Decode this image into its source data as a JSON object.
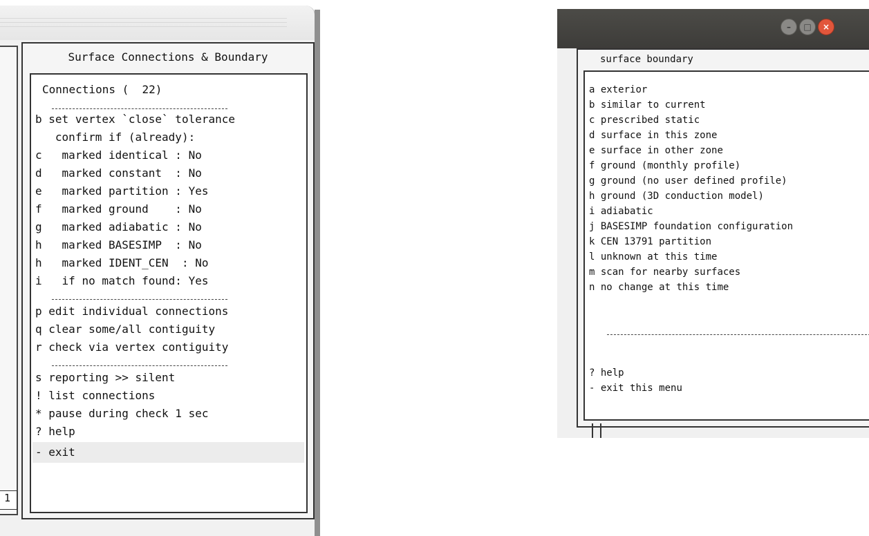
{
  "left_window": {
    "partial_field_char": "1",
    "panel_title": "Surface Connections & Boundary",
    "heading": "Connections (  22)",
    "separator": "----------------------",
    "items": [
      {
        "key": "b",
        "text": "set vertex `close` tolerance"
      },
      {
        "key": "",
        "text": " confirm if (already):"
      },
      {
        "key": "c",
        "text": "  marked identical : No"
      },
      {
        "key": "d",
        "text": "  marked constant  : No"
      },
      {
        "key": "e",
        "text": "  marked partition : Yes"
      },
      {
        "key": "f",
        "text": "  marked ground    : No"
      },
      {
        "key": "g",
        "text": "  marked adiabatic : No"
      },
      {
        "key": "h",
        "text": "  marked BASESIMP  : No"
      },
      {
        "key": "h",
        "text": "  marked IDENT_CEN  : No"
      },
      {
        "key": "i",
        "text": "  if no match found: Yes"
      }
    ],
    "items2": [
      {
        "key": "p",
        "text": "edit individual connections"
      },
      {
        "key": "q",
        "text": "clear some/all contiguity"
      },
      {
        "key": "r",
        "text": "check via vertex contiguity"
      }
    ],
    "items3": [
      {
        "key": "s",
        "text": "reporting >> silent"
      },
      {
        "key": "!",
        "text": "list connections"
      },
      {
        "key": "*",
        "text": "pause during check 1 sec"
      },
      {
        "key": "?",
        "text": "help"
      },
      {
        "key": "-",
        "text": "exit"
      }
    ]
  },
  "right_window": {
    "buttons": {
      "minimize": "–",
      "maximize": "□",
      "close": "×"
    },
    "panel_title": "surface boundary",
    "items": [
      {
        "key": "a",
        "text": "exterior"
      },
      {
        "key": "b",
        "text": "similar to current"
      },
      {
        "key": "c",
        "text": "prescribed static"
      },
      {
        "key": "d",
        "text": "surface in this zone"
      },
      {
        "key": "e",
        "text": "surface in other zone"
      },
      {
        "key": "f",
        "text": "ground (monthly profile)"
      },
      {
        "key": "g",
        "text": "ground (no user defined profile)"
      },
      {
        "key": "h",
        "text": "ground (3D conduction model)"
      },
      {
        "key": "i",
        "text": "adiabatic"
      },
      {
        "key": "j",
        "text": "BASESIMP foundation configuration"
      },
      {
        "key": "k",
        "text": "CEN 13791 partition"
      },
      {
        "key": "l",
        "text": "unknown at this time"
      },
      {
        "key": "m",
        "text": "scan for nearby surfaces"
      },
      {
        "key": "n",
        "text": "no change at this time"
      }
    ],
    "separator": "-------------------------------------",
    "footer": [
      {
        "key": "?",
        "text": "help"
      },
      {
        "key": "-",
        "text": "exit this menu"
      }
    ]
  },
  "colors": {
    "window_bg": "#f1f1f1",
    "titlebar_dark": "#3d3c39",
    "close_button": "#e2563b",
    "border": "#333333"
  }
}
